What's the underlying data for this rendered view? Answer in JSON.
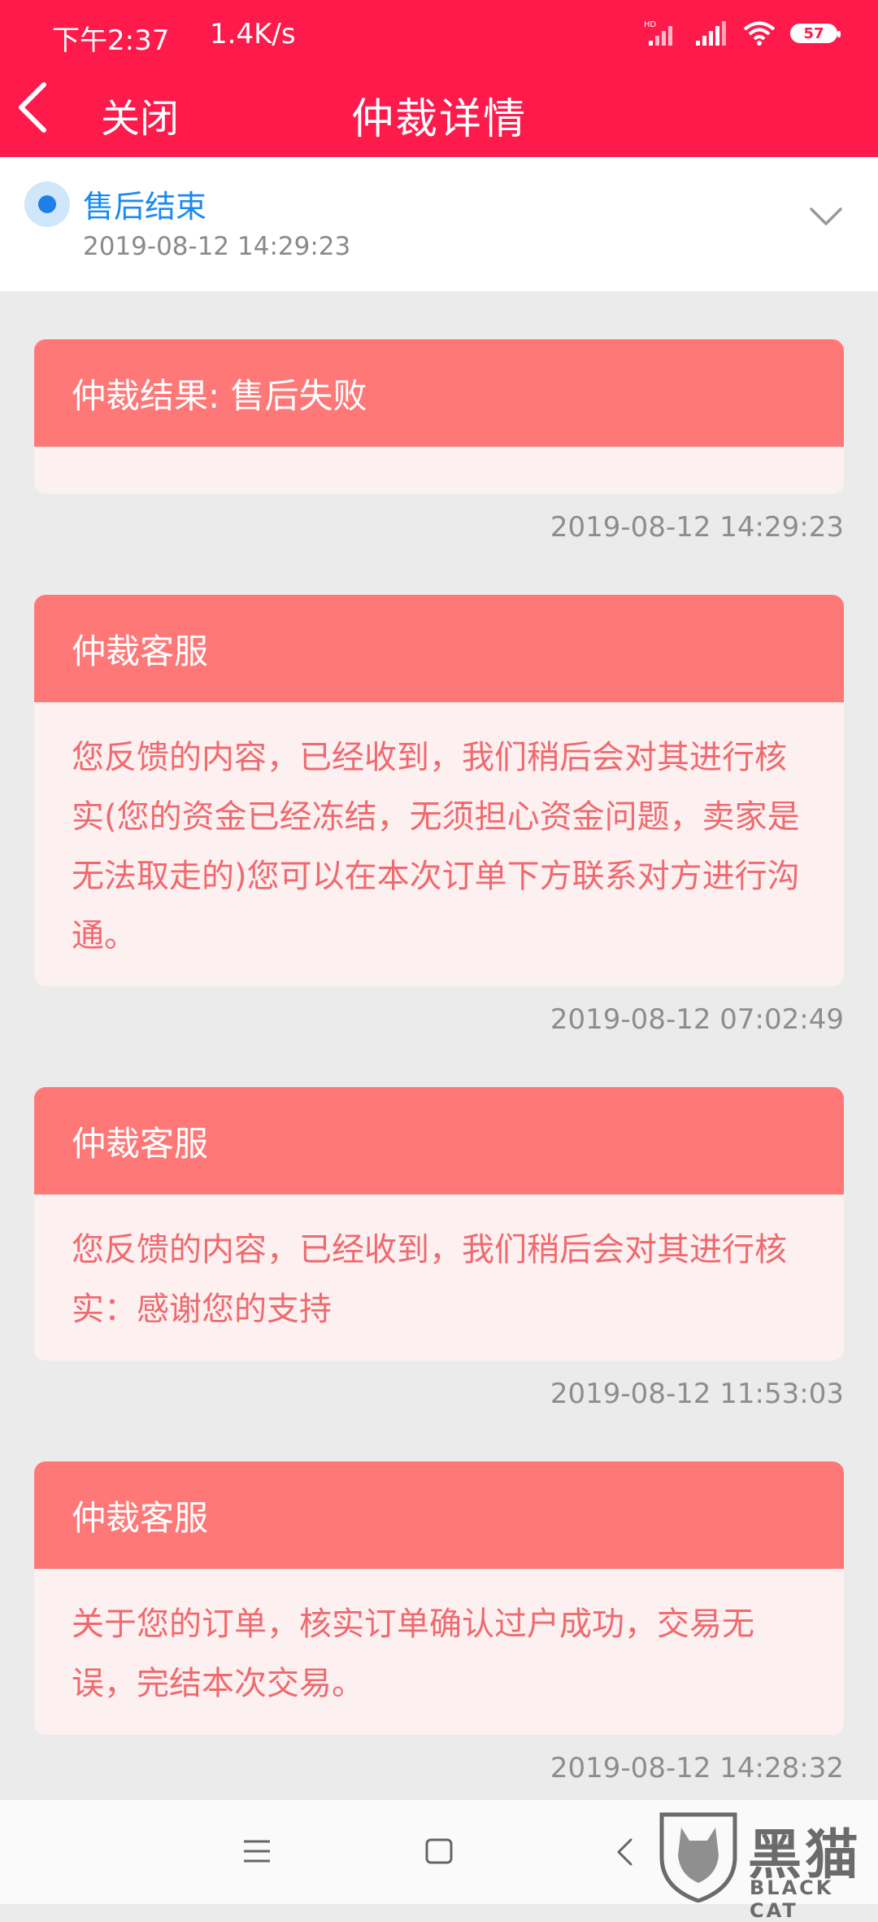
{
  "status_bar": {
    "time": "下午2:37",
    "network_speed": "1.4K/s",
    "battery": "57",
    "hd_label": "HD"
  },
  "header": {
    "close_label": "关闭",
    "title": "仲裁详情"
  },
  "progress": {
    "label": "售后结束",
    "time": "2019-08-12 14:29:23"
  },
  "cards": [
    {
      "title": "仲裁结果: 售后失败",
      "body": "",
      "time": "2019-08-12 14:29:23"
    },
    {
      "title": "仲裁客服",
      "body": "您反馈的内容，已经收到，我们稍后会对其进行核实(您的资金已经冻结，无须担心资金问题，卖家是无法取走的)您可以在本次订单下方联系对方进行沟通。",
      "time": "2019-08-12 07:02:49"
    },
    {
      "title": "仲裁客服",
      "body": "您反馈的内容，已经收到，我们稍后会对其进行核实：感谢您的支持",
      "time": "2019-08-12 11:53:03"
    },
    {
      "title": "仲裁客服",
      "body": "关于您的订单，核实订单确认过户成功，交易无误，完结本次交易。",
      "time": "2019-08-12 14:28:32"
    }
  ],
  "watermark": {
    "text": "黑猫",
    "sub": "BLACK CAT"
  },
  "colors": {
    "header_bg": "#fe1a4b",
    "card_header": "#ff7878",
    "card_body_bg": "#fdf0f1",
    "card_text": "#ef6a6e",
    "status_blue": "#1a8af0"
  },
  "icons": {
    "back": "back-arrow-icon",
    "chevron": "chevron-down-icon",
    "wifi": "wifi-icon",
    "signal": "signal-icon",
    "battery": "battery-icon",
    "menu": "menu-icon",
    "home": "home-icon",
    "nav_back": "nav-back-icon"
  }
}
